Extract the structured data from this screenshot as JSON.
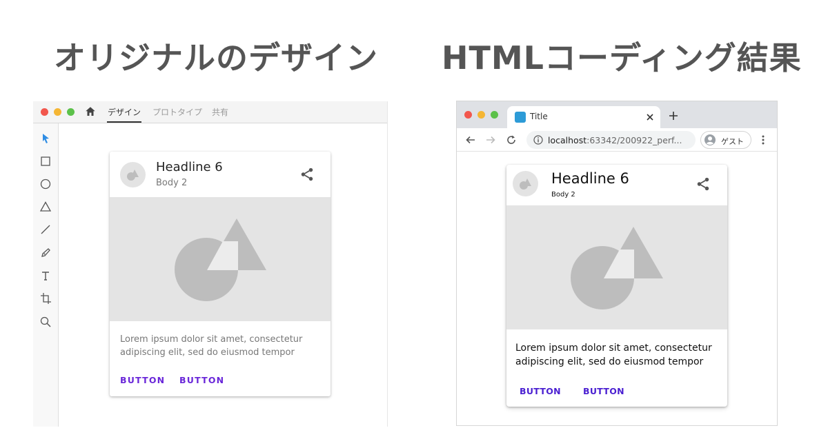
{
  "titles": {
    "left": "オリジナルのデザイン",
    "right": "HTMLコーディング結果"
  },
  "design_tool": {
    "tabs": [
      {
        "label": "デザイン",
        "active": true
      },
      {
        "label": "プロトタイプ",
        "active": false
      },
      {
        "label": "共有",
        "active": false
      }
    ],
    "tools": [
      "select-arrow-icon",
      "rectangle-icon",
      "ellipse-icon",
      "triangle-icon",
      "line-icon",
      "pen-icon",
      "text-icon",
      "artboard-icon",
      "zoom-icon"
    ],
    "card": {
      "headline": "Headline 6",
      "subtitle": "Body 2",
      "body": "Lorem ipsum dolor sit amet, consectetur adipiscing elit, sed do eiusmod tempor",
      "button1": "BUTTON",
      "button2": "BUTTON"
    }
  },
  "browser": {
    "tab_title": "Title",
    "url_host": "localhost",
    "url_rest": ":63342/200922_perf...",
    "guest_label": "ゲスト",
    "card": {
      "headline": "Headline 6",
      "subtitle": "Body 2",
      "body": "Lorem ipsum dolor sit amet, consectetur adipiscing elit, sed do eiusmod tempor",
      "button1": "BUTTON",
      "button2": "BUTTON"
    }
  },
  "colors": {
    "accent_design": "#6a27d9",
    "accent_html": "#4a1fd1",
    "media_bg": "#e4e4e4",
    "shape": "#bdbdbd"
  }
}
